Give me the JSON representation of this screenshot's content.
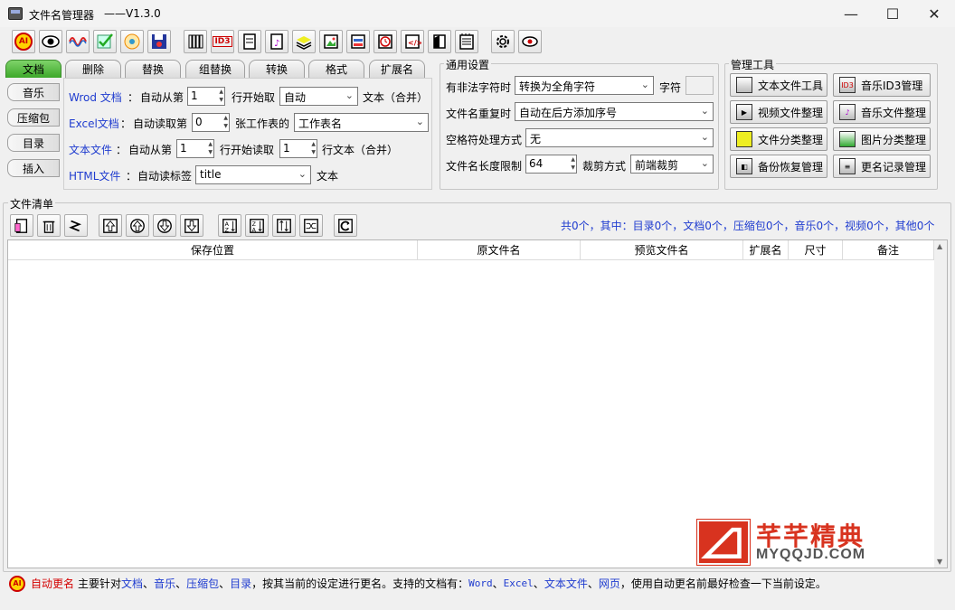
{
  "window": {
    "title": "文件名管理器",
    "version": "——V1.3.0",
    "min": "—",
    "max": "☐",
    "close": "✕"
  },
  "toolbar": [
    "AI",
    "eye",
    "wave",
    "check",
    "flower",
    "disk",
    "books",
    "ID3",
    "doc",
    "music",
    "stack",
    "image",
    "form",
    "clock",
    "code",
    "film",
    "list",
    "gear",
    "eye2"
  ],
  "tabs": [
    "文档",
    "删除",
    "替换",
    "组替换",
    "转换",
    "格式",
    "扩展名"
  ],
  "side_tabs": [
    "音乐",
    "压缩包",
    "目录",
    "插入"
  ],
  "doc": {
    "word_label": "Wrod 文档",
    "word_colon": "：",
    "auto_from": "自动从第",
    "word_num": "1",
    "line_start_take": "行开始取",
    "word_mode": "自动",
    "text_merge": "文本（合并）",
    "excel_label": "Excel文档",
    "excel_colon": "：",
    "auto_read": "自动读取第",
    "excel_num": "0",
    "sheet_of": "张工作表的",
    "sheet_name": "工作表名",
    "txt_label": "文本文件",
    "txt_colon": "：",
    "txt_auto_from": "自动从第",
    "txt_num": "1",
    "line_start_read": "行开始读取",
    "txt_num2": "1",
    "line_text_merge": "行文本（合并）",
    "html_label": "HTML文件",
    "html_colon": "：",
    "auto_read_tag": "自动读标签",
    "html_tag": "title",
    "html_text": "文本"
  },
  "general": {
    "title": "通用设置",
    "illegal_label": "有非法字符时",
    "illegal_value": "转换为全角字符",
    "char_label": "字符",
    "dup_label": "文件名重复时",
    "dup_value": "自动在后方添加序号",
    "space_label": "空格符处理方式",
    "space_value": "无",
    "len_label": "文件名长度限制",
    "len_value": "64",
    "crop_label": "裁剪方式",
    "crop_value": "前端裁剪"
  },
  "tools": {
    "title": "管理工具",
    "buttons": [
      "文本文件工具",
      "音乐ID3管理",
      "视频文件整理",
      "音乐文件整理",
      "文件分类整理",
      "图片分类整理",
      "备份恢复管理",
      "更名记录管理"
    ]
  },
  "list": {
    "title": "文件清单",
    "summary": "共0个，其中：目录0个，文档0个，压缩包0个，音乐0个，视频0个，其他0个",
    "columns": [
      "保存位置",
      "原文件名",
      "预览文件名",
      "扩展名",
      "尺寸",
      "备注"
    ]
  },
  "status": {
    "icon": "AI",
    "auto": "自动更名",
    "t1": "主要针对",
    "doc": "文档",
    "s1": "、",
    "music": "音乐",
    "s2": "、",
    "zip": "压缩包",
    "s3": "、",
    "dir": "目录",
    "t2": "，按其当前的设定进行更名。支持的文档有：",
    "word": "Word",
    "s4": "、",
    "excel": "Excel",
    "s5": "、",
    "txt": "文本文件",
    "s6": "、",
    "web": "网页",
    "t3": "，使用自动更名前最好检查一下当前设定。"
  },
  "watermark": {
    "cn": "芊芊精典",
    "en": "MYQQJD.COM"
  }
}
